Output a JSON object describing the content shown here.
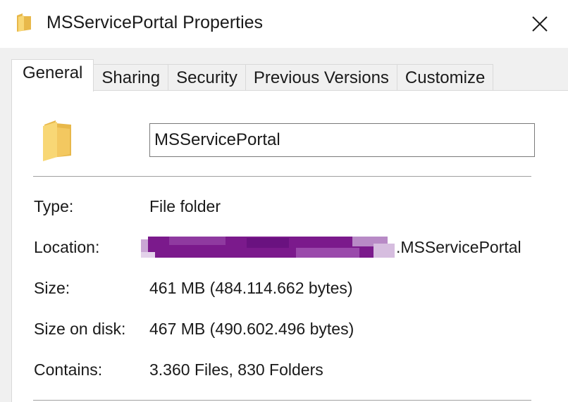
{
  "window": {
    "title": "MSServicePortal Properties",
    "icon": "folder-icon",
    "close_icon": "close-icon"
  },
  "tabs": [
    {
      "label": "General",
      "active": true
    },
    {
      "label": "Sharing",
      "active": false
    },
    {
      "label": "Security",
      "active": false
    },
    {
      "label": "Previous Versions",
      "active": false
    },
    {
      "label": "Customize",
      "active": false
    }
  ],
  "general": {
    "folder_name": "MSServicePortal",
    "properties": {
      "type": {
        "label": "Type:",
        "value": "File folder"
      },
      "location": {
        "label": "Location:",
        "value_suffix": ".MSServicePortal",
        "redacted": true
      },
      "size": {
        "label": "Size:",
        "value": "461 MB (484.114.662 bytes)"
      },
      "size_on_disk": {
        "label": "Size on disk:",
        "value": "467 MB (490.602.496 bytes)"
      },
      "contains": {
        "label": "Contains:",
        "value": "3.360 Files, 830 Folders"
      }
    }
  },
  "colors": {
    "folder_yellow": "#f8d775",
    "folder_dark": "#e8b84a",
    "redaction_purple": "#7b1a8c"
  }
}
